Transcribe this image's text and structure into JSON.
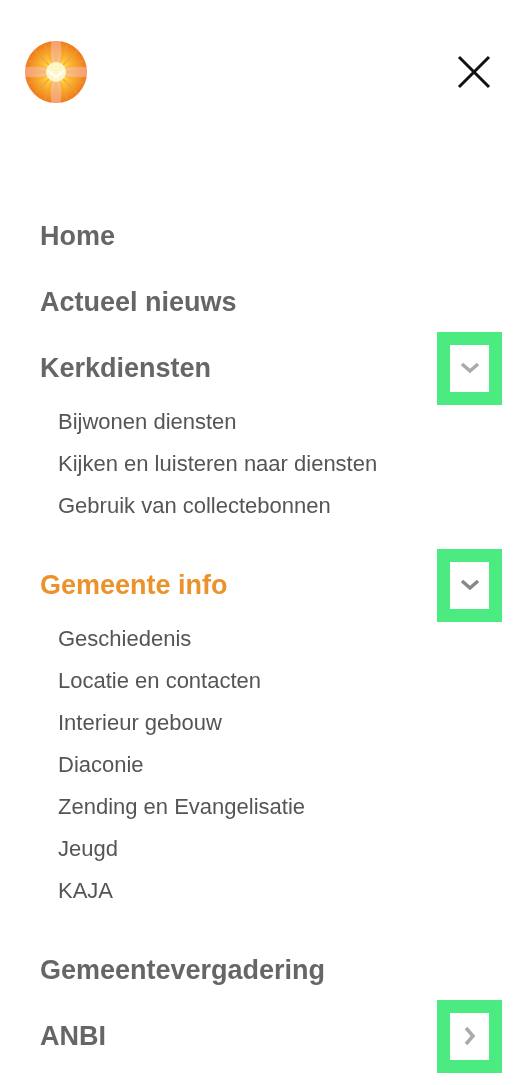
{
  "menu": [
    {
      "label": "Home",
      "kind": "link",
      "selected": false
    },
    {
      "label": "Actueel nieuws",
      "kind": "link",
      "selected": false
    },
    {
      "label": "Kerkdiensten",
      "kind": "submenu",
      "selected": false,
      "expanded": true,
      "children": [
        {
          "label": "Bijwonen diensten"
        },
        {
          "label": "Kijken en luisteren naar diensten"
        },
        {
          "label": "Gebruik van collectebonnen"
        }
      ]
    },
    {
      "label": "Gemeente info",
      "kind": "submenu",
      "selected": true,
      "expanded": true,
      "children": [
        {
          "label": "Geschiedenis"
        },
        {
          "label": "Locatie en contacten"
        },
        {
          "label": "Interieur gebouw"
        },
        {
          "label": "Diaconie"
        },
        {
          "label": "Zending en Evangelisatie"
        },
        {
          "label": "Jeugd"
        },
        {
          "label": "KAJA"
        }
      ]
    },
    {
      "label": "Gemeentevergadering",
      "kind": "link",
      "selected": false
    },
    {
      "label": "ANBI",
      "kind": "submenu",
      "selected": false,
      "expanded": false
    }
  ]
}
